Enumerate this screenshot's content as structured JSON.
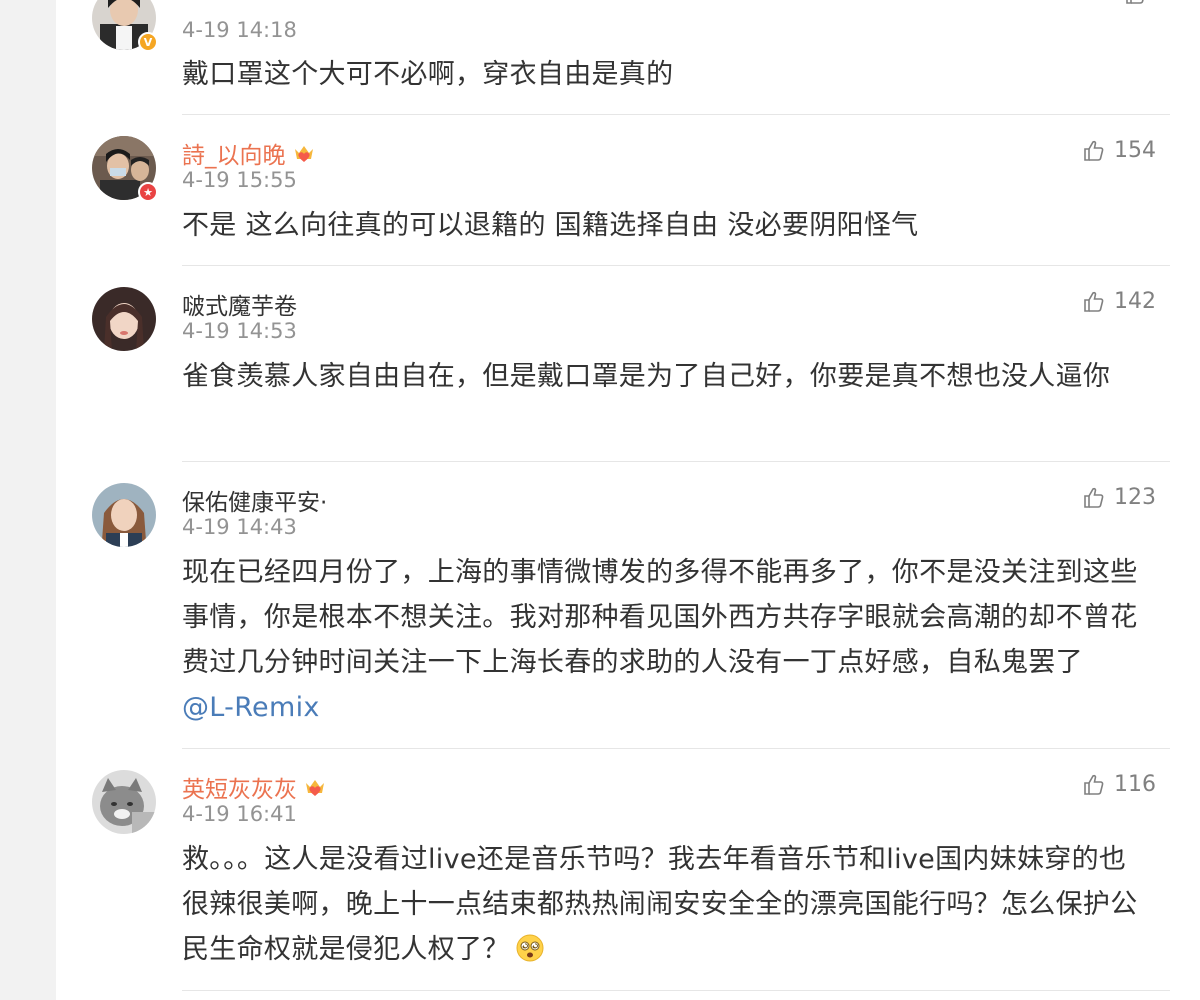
{
  "comments": [
    {
      "username": "",
      "time": "4-19 14:18",
      "likes": "",
      "text": "戴口罩这个大可不必啊，穿衣自由是真的",
      "badge": "verified-yellow"
    },
    {
      "username": "詩_以向晚",
      "time": "4-19 15:55",
      "likes": "154",
      "text": "不是 这么向往真的可以退籍的 国籍选择自由 没必要阴阳怪气",
      "badge": "verified-red"
    },
    {
      "username": "啵式魔芋卷",
      "time": "4-19 14:53",
      "likes": "142",
      "text": "雀食羡慕人家自由自在，但是戴口罩是为了自己好，你要是真不想也没人逼你"
    },
    {
      "username": "保佑健康平安·",
      "time": "4-19 14:43",
      "likes": "123",
      "text": "现在已经四月份了，上海的事情微博发的多得不能再多了，你不是没关注到这些事情，你是根本不想关注。我对那种看见国外西方共存字眼就会高潮的却不曾花费过几分钟时间关注一下上海长春的求助的人没有一丁点好感，自私鬼罢了 ",
      "mention": "@L-Remix"
    },
    {
      "username": "英短灰灰灰",
      "time": "4-19 16:41",
      "likes": "116",
      "text": "救。。。这人是没看过live还是音乐节吗？我去年看音乐节和live国内妹妹穿的也很辣很美啊，晚上十一点结束都热热闹闹安安全全的漂亮国能行吗？怎么保护公民生命权就是侵犯人权了？",
      "emoji": "dizzy-face-icon"
    }
  ],
  "colors": {
    "vip_name": "#eb7350",
    "mention": "#4a7cb8",
    "verified_yellow": "#f5a623",
    "verified_red": "#e94343"
  }
}
